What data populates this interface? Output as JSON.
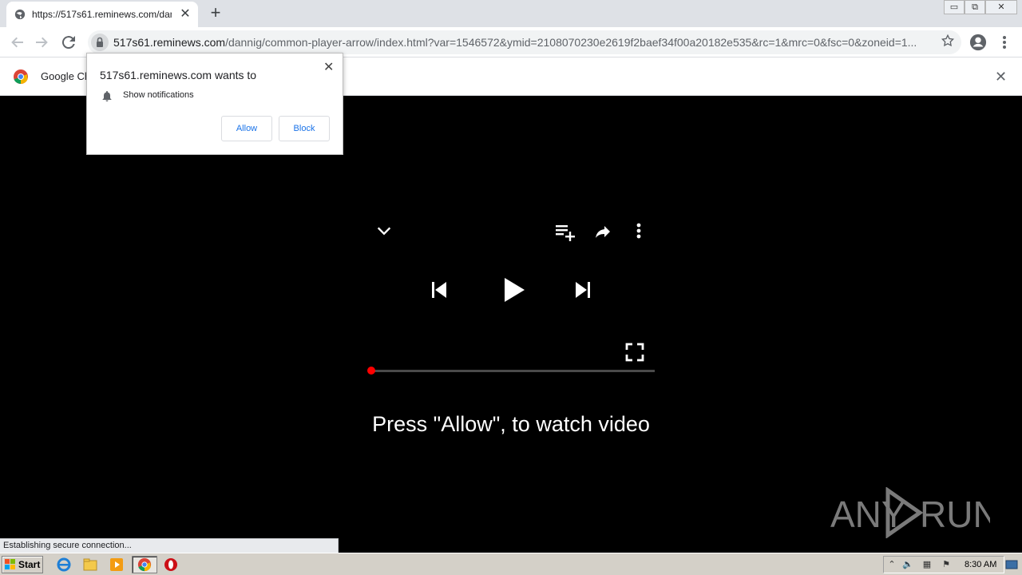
{
  "browser": {
    "tab_title": "https://517s61.reminews.com/dannig",
    "tab_close": "✕",
    "new_tab": "+",
    "window_controls": [
      "▭",
      "⧉",
      "✕"
    ],
    "url_host": "517s61.reminews.com",
    "url_rest": "/dannig/common-player-arrow/index.html?var=1546572&ymid=2108070230e2619f2baef34f00a20182e535&rc=1&mrc=0&fsc=0&zoneid=1...",
    "infobar_text": "Google Ch",
    "infobar_close": "✕"
  },
  "popup": {
    "origin": "517s61.reminews.com wants to",
    "permission": "Show notifications",
    "allow_label": "Allow",
    "block_label": "Block",
    "close": "✕"
  },
  "player": {
    "cta": "Press \"Allow\", to watch video",
    "progress": 0.0,
    "progress_color": "#ff0000"
  },
  "watermark": {
    "left": "ANY",
    "right": "RUN"
  },
  "status_bar": {
    "text": "Establishing secure connection..."
  },
  "taskbar": {
    "start_label": "Start",
    "clock": "8:30 AM"
  }
}
